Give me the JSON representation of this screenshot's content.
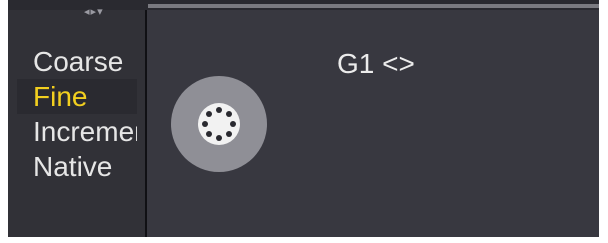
{
  "header": {
    "arrows_icon": "left-right-down-arrows",
    "arrows_glyphs": [
      "◂",
      "▸",
      "▾"
    ]
  },
  "precision": {
    "items": [
      "Coarse",
      "Fine",
      "Increment",
      "Native"
    ],
    "selected_index": 1,
    "selected_color": "#f2cf1f"
  },
  "main": {
    "label": "G1 <>"
  },
  "dial": {
    "icon": "jog-dial-icon"
  },
  "colors": {
    "panel": "#383840",
    "sidebar": "#313137",
    "dial": "#8f8f96",
    "text": "#e6e6e6"
  }
}
